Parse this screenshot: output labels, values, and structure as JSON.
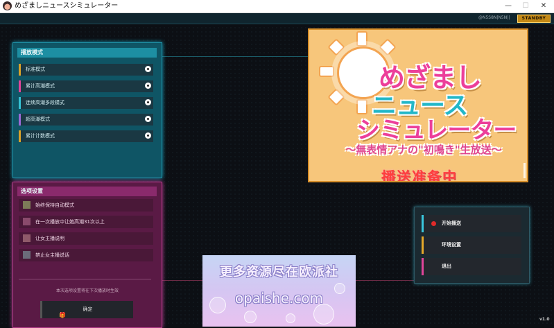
{
  "window": {
    "title": "めざましニュースシミュレーター",
    "min": "—",
    "max": "☐",
    "close": "✕"
  },
  "topbar": {
    "status_time": "@N5S8N|N5N||",
    "standby_label": "STANDBY"
  },
  "modes": {
    "title": "播放模式",
    "items": [
      {
        "label": "标准模式",
        "color": "#d9a22a"
      },
      {
        "label": "累计高潮模式",
        "color": "#e0459a"
      },
      {
        "label": "连续高潮多段模式",
        "color": "#35c2d4"
      },
      {
        "label": "超高潮模式",
        "color": "#9a6ad6"
      },
      {
        "label": "累计计数模式",
        "color": "#d9a22a"
      }
    ]
  },
  "options": {
    "title": "选项设置",
    "items": [
      {
        "label": "始终保持自动模式",
        "color": "#7d7b58"
      },
      {
        "label": "在一次播放中让她高潮31次以上",
        "color": "#8a4a6c"
      },
      {
        "label": "让女主播说明",
        "color": "#8f5a6a"
      },
      {
        "label": "禁止女主播说话",
        "color": "#6b6b7a"
      }
    ],
    "note": "本次选项设置将在下次播放时生效",
    "confirm_label": "确定",
    "gift_icon": "🎁"
  },
  "hero": {
    "logo_line1": "めざまし",
    "logo_line2": "ニュース",
    "logo_line3": "シミュレーター",
    "subtitle": "～無表情アナの\"初鳴き\"生放送～",
    "ready_text": "播送准备中"
  },
  "menu": {
    "start_label": "开始播送",
    "settings_label": "环境设置",
    "exit_label": "退出",
    "colors": {
      "start": "#3ac6dc",
      "settings": "#e6a92a",
      "exit": "#e0459a"
    }
  },
  "promo": {
    "line1": "更多资源尽在欧派社",
    "line2": "opaishe.com"
  },
  "version": "v1.0"
}
